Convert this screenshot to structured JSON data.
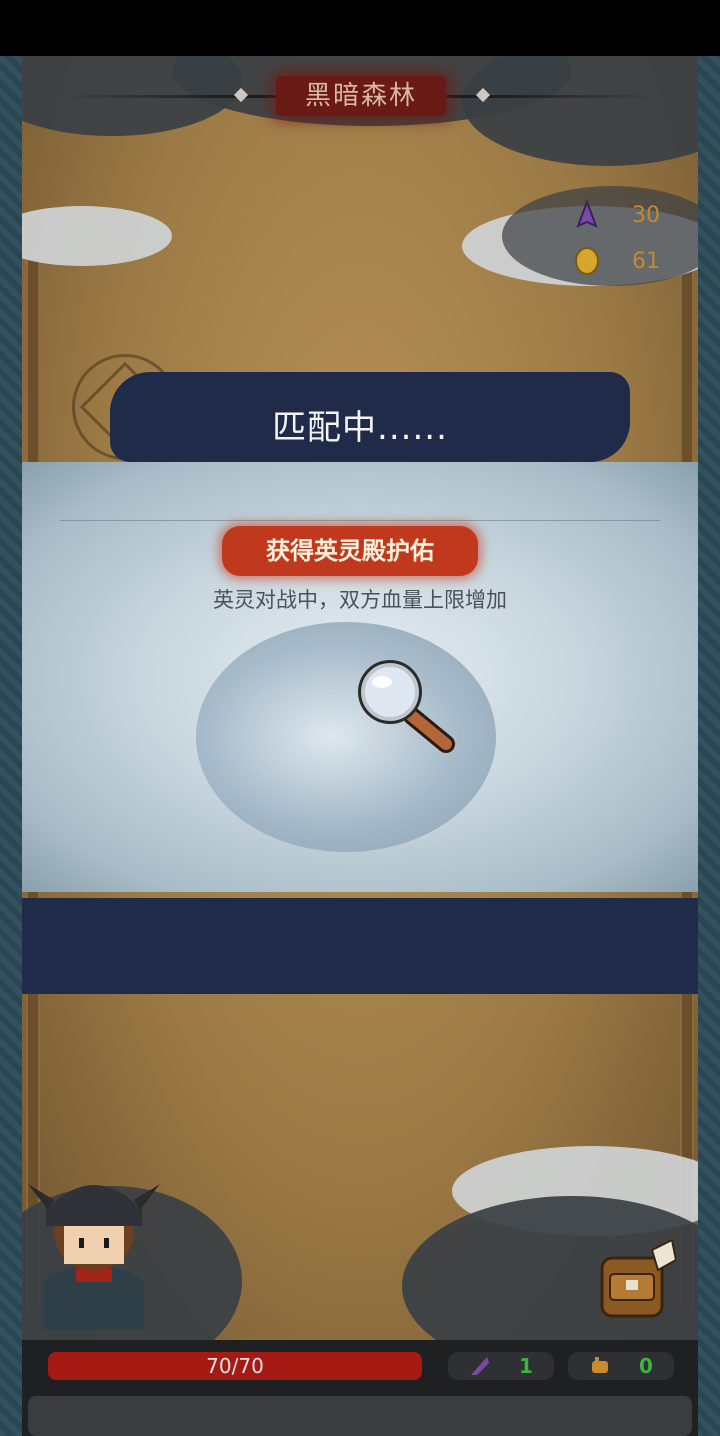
{
  "top_bar": {
    "title": "黑暗森林"
  },
  "resources": {
    "gems": "30",
    "coins": "61",
    "gem_icon": "purple-crystal",
    "coin_icon": "gold-coin"
  },
  "match_modal": {
    "title": "匹配中......",
    "blessing_badge": "获得英灵殿护佑",
    "description": "英灵对战中，双方血量上限增加",
    "search_icon": "magnifying-glass"
  },
  "bottom_bar": {
    "hp": "70/70",
    "crystal_count": "1",
    "power_count": "0"
  },
  "colors": {
    "hp_red": "#a61a14",
    "badge_red": "#c0391f",
    "band_navy": "#1f2b48",
    "gold": "#c28a33",
    "count_green": "#3db43d"
  }
}
